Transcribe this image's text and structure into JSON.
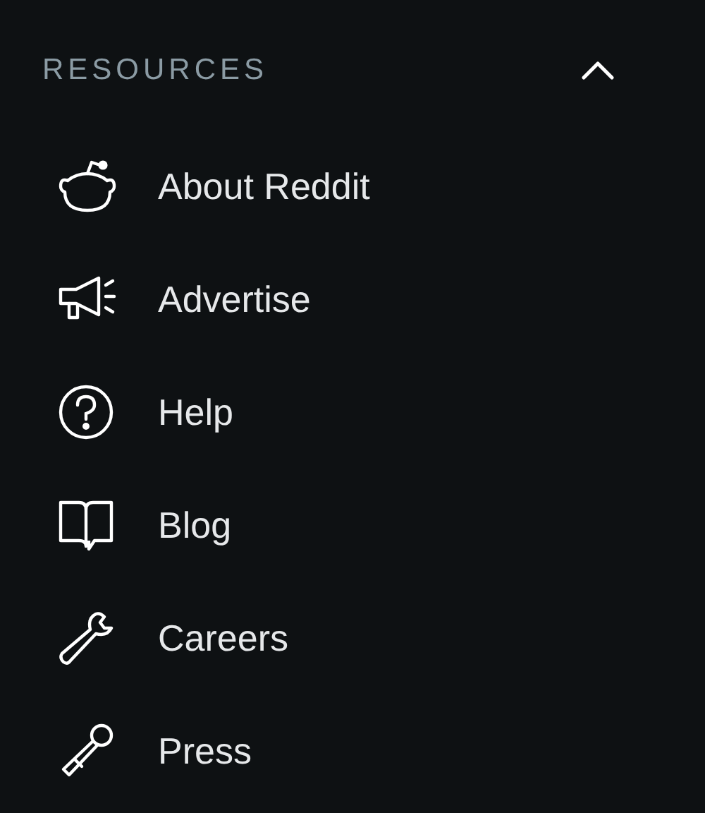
{
  "section": {
    "title": "RESOURCES",
    "expanded": true
  },
  "items": [
    {
      "kind": "alien",
      "label": "About Reddit"
    },
    {
      "kind": "megaphone",
      "label": "Advertise"
    },
    {
      "kind": "help",
      "label": "Help"
    },
    {
      "kind": "book",
      "label": "Blog"
    },
    {
      "kind": "wrench",
      "label": "Careers"
    },
    {
      "kind": "microphone",
      "label": "Press"
    }
  ]
}
